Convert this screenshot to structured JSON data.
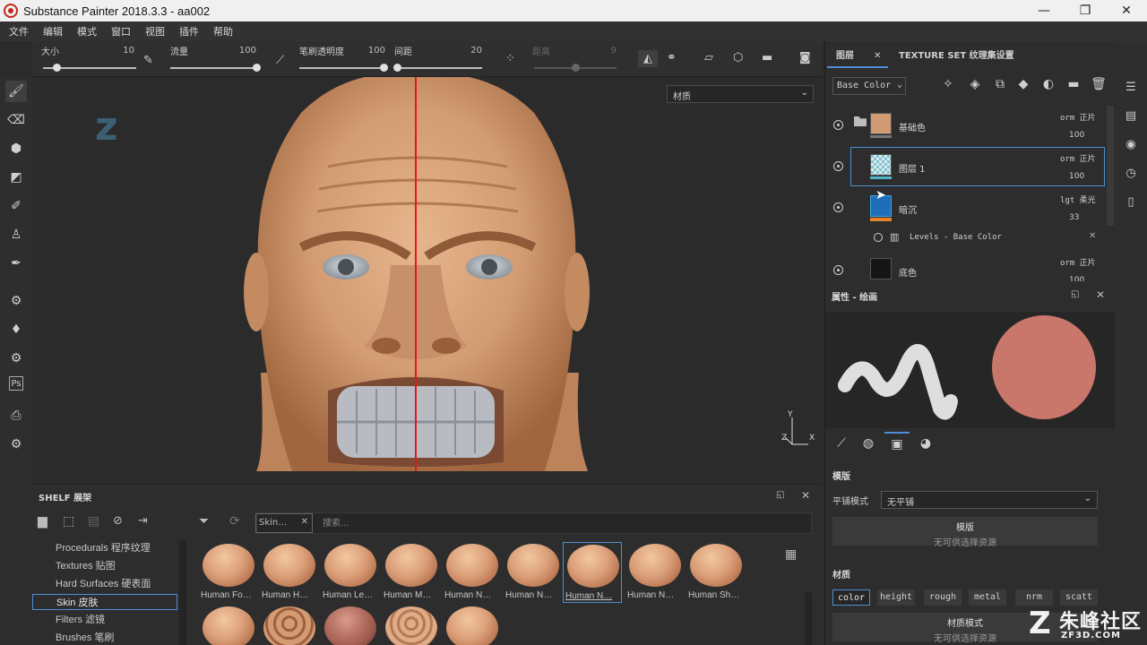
{
  "window": {
    "title": "Substance Painter 2018.3.3 - aa002",
    "minimize": "—",
    "maximize": "❐",
    "close": "✕"
  },
  "menu": [
    "文件",
    "编辑",
    "模式",
    "窗口",
    "视图",
    "插件",
    "帮助"
  ],
  "tool_options": {
    "size": {
      "label": "大小",
      "value": "10",
      "level": 0.15
    },
    "flow": {
      "label": "流量",
      "value": "100",
      "level": 1.0
    },
    "stroke_opacity": {
      "label": "笔刷透明度",
      "value": "100",
      "level": 1.0
    },
    "spacing": {
      "label": "间距",
      "value": "20",
      "level": 0.02
    },
    "distance": {
      "label": "距离",
      "value": "9",
      "level": 0.5,
      "enabled": false
    }
  },
  "viewport": {
    "material_mode": "材质",
    "axis_y": "Y",
    "axis_x": "X",
    "axis_z": "Z"
  },
  "layers_panel": {
    "tab_layers": "图层",
    "tab_texture_set": "TEXTURE SET 纹理集设置",
    "channel": "Base Color",
    "layers": [
      {
        "name": "基础色",
        "blend": "orm 正片",
        "opacity": "100",
        "thumb_color": "#d09a72",
        "is_folder": true
      },
      {
        "name": "图层 1",
        "blend": "orm 正片",
        "opacity": "100",
        "thumb_color": "#4fb6c9",
        "selected": true
      },
      {
        "name": "暗沉",
        "blend": "lgt 柔光",
        "opacity": "33",
        "thumb_color": "#1f6fb8"
      },
      {
        "name": "底色",
        "blend": "orm 正片",
        "opacity": "100",
        "thumb_color": "#151515"
      }
    ],
    "filter": {
      "name": "Levels - Base Color"
    }
  },
  "properties": {
    "title": "属性 - 绘画",
    "stencil_section": "模版",
    "tiling_label": "平铺模式",
    "tiling_value": "无平铺",
    "stencil_slot_title": "模版",
    "stencil_slot_empty": "无可供选择资源",
    "material_section": "材质",
    "channels": [
      "color",
      "height",
      "rough",
      "metal",
      "nrm",
      "scatt"
    ],
    "material_mode_title": "材质模式",
    "material_mode_empty": "无可供选择资源",
    "sphere_color": "#c9776a"
  },
  "shelf": {
    "title": "SHELF 展架",
    "categories": [
      "Procedurals 程序纹理",
      "Textures 贴图",
      "Hard Surfaces 硬表面",
      "Skin 皮肤",
      "Filters 滤镜",
      "Brushes 笔刷"
    ],
    "active_category": 3,
    "filter_chip": "Skin…",
    "search_placeholder": "搜索...",
    "items": [
      "Human Fo…",
      "Human H…",
      "Human Le…",
      "Human M…",
      "Human N…",
      "Human N…",
      "Human N…",
      "Human N…",
      "Human Sh…"
    ],
    "selected_item": 6
  },
  "watermark": {
    "text": "朱峰社区",
    "sub": "ZF3D.COM"
  }
}
